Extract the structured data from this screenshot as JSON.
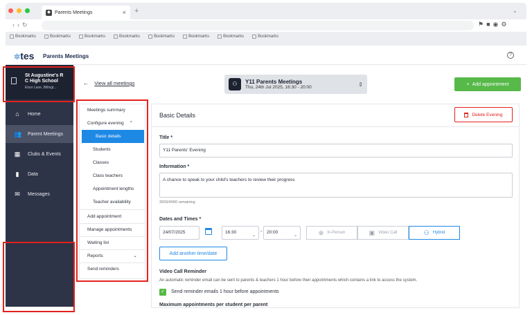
{
  "browser": {
    "tab_title": "Parents Meetings",
    "bookmarks": [
      "Bookmarks",
      "Bookmarks",
      "Bookmarks",
      "Bookmarks",
      "Bookmarks",
      "Bookmarks",
      "Bookmarks",
      "Bookmarks"
    ]
  },
  "app": {
    "logo": "tes",
    "title": "Parents Meetings"
  },
  "school": {
    "name_line1": "St Augustine's R",
    "name_line2": "C High School",
    "address": "Elsor Lane, Billingt..."
  },
  "sidebar": {
    "items": [
      {
        "label": "Home",
        "icon": "home-icon"
      },
      {
        "label": "Parent Meetings",
        "icon": "people-icon"
      },
      {
        "label": "Clubs & Events",
        "icon": "calendar-icon"
      },
      {
        "label": "Data",
        "icon": "bar-chart-icon"
      },
      {
        "label": "Messages",
        "icon": "mail-icon"
      }
    ]
  },
  "subnav": {
    "summary": "Meetings summary",
    "configure": "Configure evening",
    "children": [
      "Basic details",
      "Students",
      "Classes",
      "Class teachers",
      "Appointment lengths",
      "Teacher availability"
    ],
    "add_appointment": "Add appointment",
    "manage_appointments": "Manage appointments",
    "waiting_list": "Waiting list",
    "reports": "Reports",
    "send_reminders": "Send reminders"
  },
  "topbar": {
    "back_link": "View all meetings",
    "event_name": "Y11 Parents Meetings",
    "event_date": "Thu, 24th Jul 2025, 16:30 - 20:00",
    "add_appointment": "Add appointment"
  },
  "basic": {
    "heading": "Basic Details",
    "delete_label": "Delete Evening",
    "title_label": "Title *",
    "title_value": "Y11 Parents' Evening",
    "info_label": "Information *",
    "info_value": "A chance to speak to your child's teachers to review their progress",
    "remaining": "3933/4000 remaining",
    "dates_label": "Dates and Times *",
    "date_value": "24/07/2025",
    "start_time": "16:30",
    "dash": "-",
    "end_time": "20:00",
    "modes": [
      "In-Person",
      "Video Call",
      "Hybrid"
    ],
    "add_time": "Add another time/date",
    "video_heading": "Video Call Reminder",
    "video_desc": "An automatic reminder email can be sent to parents & teachers 1 hour before their appointments which contains a link to access the system.",
    "reminder_label": "Send reminder emails 1 hour before appointments",
    "max_heading": "Maximum appointments per student per parent"
  },
  "colors": {
    "accent": "#1e88e5",
    "success": "#56b948",
    "danger": "#e3201b",
    "sidebar": "#2e3447"
  }
}
